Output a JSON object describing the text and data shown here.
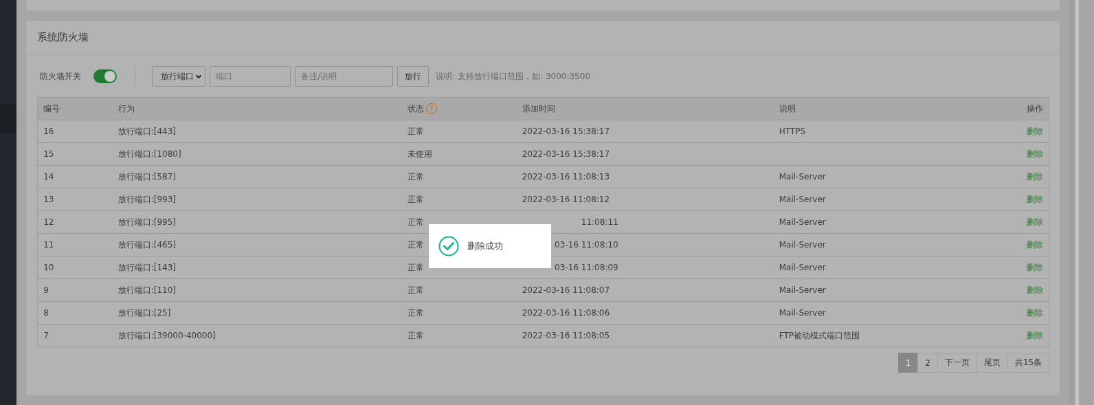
{
  "page_title": "系统防火墙",
  "toolbar": {
    "switch_label": "防火墙开关",
    "switch_on": true,
    "rule_type": "放行端口",
    "port_placeholder": "端口",
    "note_placeholder": "备注/说明",
    "submit": "放行",
    "hint": "说明: 支持放行端口范围，如: 3000:3500"
  },
  "table": {
    "columns": [
      "编号",
      "行为",
      "状态",
      "添加时间",
      "说明",
      "操作"
    ],
    "status_help": "?",
    "rows": [
      {
        "id": "16",
        "action": "放行端口:[443]",
        "status": "正常",
        "time": "2022-03-16 15:38:17",
        "note": "HTTPS",
        "op": "删除"
      },
      {
        "id": "15",
        "action": "放行端口:[1080]",
        "status": "未使用",
        "time": "2022-03-16 15:38:17",
        "note": "",
        "op": "删除"
      },
      {
        "id": "14",
        "action": "放行端口:[587]",
        "status": "正常",
        "time": "2022-03-16 11:08:13",
        "note": "Mail-Server",
        "op": "删除"
      },
      {
        "id": "13",
        "action": "放行端口:[993]",
        "status": "正常",
        "time": "2022-03-16 11:08:12",
        "note": "Mail-Server",
        "op": "删除"
      },
      {
        "id": "12",
        "action": "放行端口:[995]",
        "status": "正常",
        "time": "11:08:11",
        "time_clipped": true,
        "note": "Mail-Server",
        "op": "删除"
      },
      {
        "id": "11",
        "action": "放行端口:[465]",
        "status": "正常",
        "time": "03-16 11:08:10",
        "time_clipped": true,
        "note": "Mail-Server",
        "op": "删除"
      },
      {
        "id": "10",
        "action": "放行端口:[143]",
        "status": "正常",
        "time": "03-16 11:08:09",
        "time_clipped": true,
        "note": "Mail-Server",
        "op": "删除"
      },
      {
        "id": "9",
        "action": "放行端口:[110]",
        "status": "正常",
        "time": "2022-03-16 11:08:07",
        "note": "Mail-Server",
        "op": "删除"
      },
      {
        "id": "8",
        "action": "放行端口:[25]",
        "status": "正常",
        "time": "2022-03-16 11:08:06",
        "note": "Mail-Server",
        "op": "删除"
      },
      {
        "id": "7",
        "action": "放行端口:[39000-40000]",
        "status": "正常",
        "time": "2022-03-16 11:08:05",
        "note": "FTP被动模式端口范围",
        "op": "删除"
      }
    ]
  },
  "pagination": {
    "pages": [
      {
        "label": "1",
        "selected": true
      },
      {
        "label": "2",
        "selected": false
      }
    ],
    "next": "下一页",
    "last": "尾页",
    "total": "共15条"
  },
  "toast": {
    "message": "删除成功"
  }
}
